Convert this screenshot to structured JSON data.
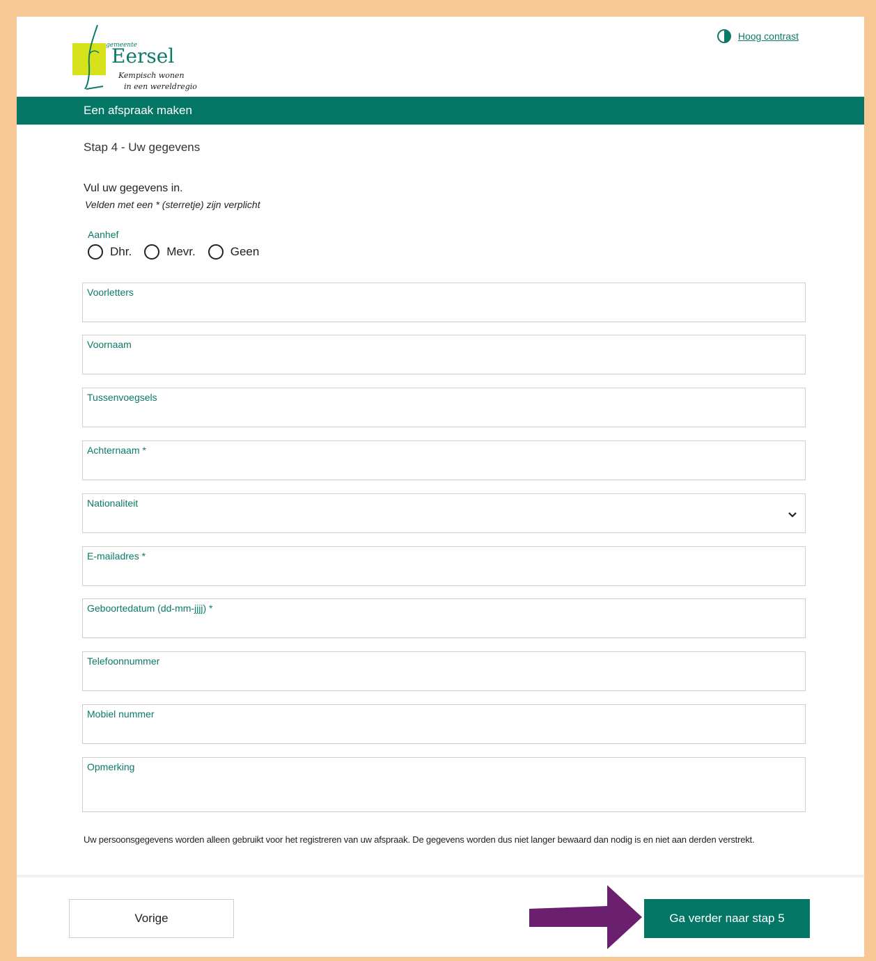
{
  "brand": {
    "municipality_prefix": "gemeente",
    "name": "Eersel",
    "tagline_line1": "Kempisch wonen",
    "tagline_line2": "in een wereldregio"
  },
  "header": {
    "contrast_link": "Hoog contrast"
  },
  "banner": {
    "title": "Een afspraak maken"
  },
  "step": {
    "title": "Stap 4 - Uw gegevens",
    "intro": "Vul uw gegevens in.",
    "required_note": "Velden met een * (sterretje) zijn verplicht"
  },
  "salutation": {
    "label": "Aanhef",
    "options": [
      "Dhr.",
      "Mevr.",
      "Geen"
    ]
  },
  "fields": {
    "initials": {
      "label": "Voorletters",
      "value": ""
    },
    "first_name": {
      "label": "Voornaam",
      "value": ""
    },
    "infix": {
      "label": "Tussenvoegsels",
      "value": ""
    },
    "last_name": {
      "label": "Achternaam *",
      "value": ""
    },
    "nationality": {
      "label": "Nationaliteit",
      "value": ""
    },
    "email": {
      "label": "E-mailadres *",
      "value": ""
    },
    "birthdate": {
      "label": "Geboortedatum (dd-mm-jjjj) *",
      "value": ""
    },
    "phone": {
      "label": "Telefoonnummer",
      "value": ""
    },
    "mobile": {
      "label": "Mobiel nummer",
      "value": ""
    },
    "remark": {
      "label": "Opmerking",
      "value": ""
    }
  },
  "privacy_text": "Uw persoonsgegevens worden alleen gebruikt voor het registreren van uw afspraak. De gegevens worden dus niet langer bewaard dan nodig is en niet aan derden verstrekt.",
  "buttons": {
    "previous": "Vorige",
    "next": "Ga verder naar stap 5"
  },
  "colors": {
    "primary": "#047666",
    "label": "#0b7a67",
    "page_border": "#f7c896",
    "logo_yellow": "#d6e11b",
    "annotation_arrow": "#6a1f6f"
  }
}
